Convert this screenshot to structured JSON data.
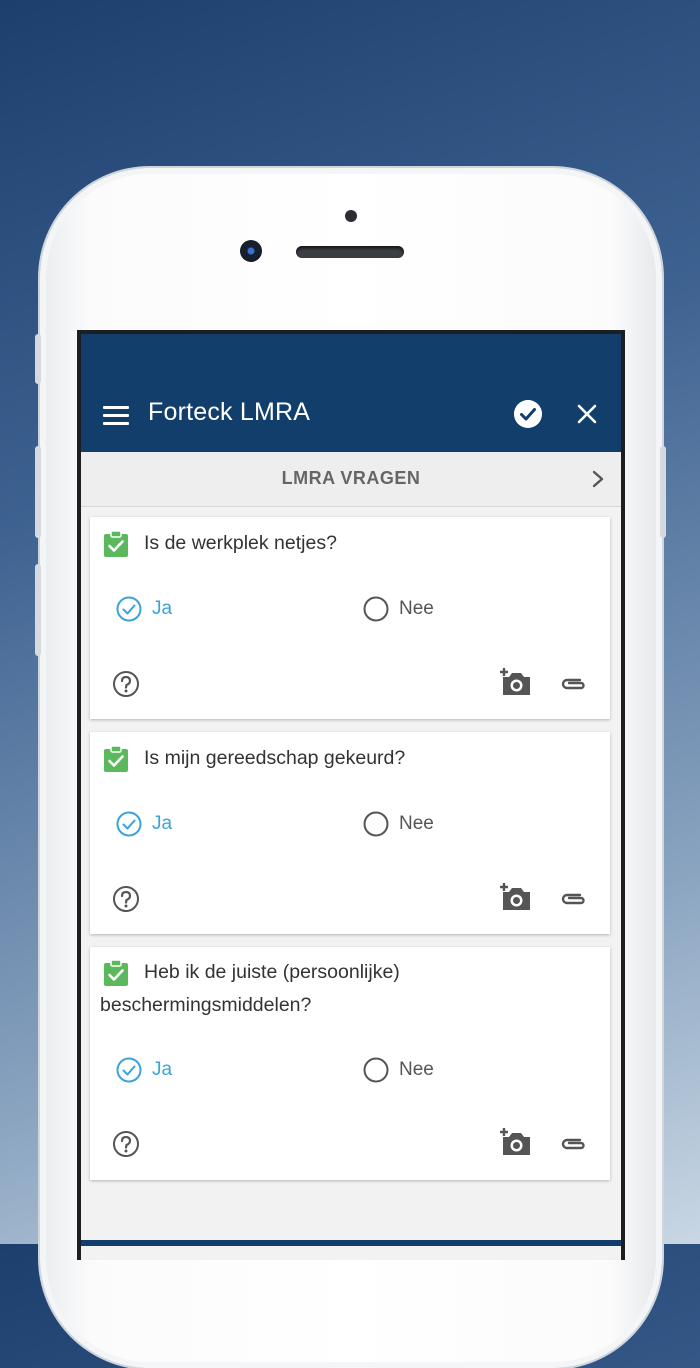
{
  "app": {
    "title": "Forteck LMRA"
  },
  "tab": {
    "label": "LMRA VRAGEN"
  },
  "questions": [
    {
      "text": "Is de werkplek netjes?",
      "yes_label": "Ja",
      "no_label": "Nee",
      "selected": "yes"
    },
    {
      "text": "Is mijn gereedschap gekeurd?",
      "yes_label": "Ja",
      "no_label": "Nee",
      "selected": "yes"
    },
    {
      "text": "Heb ik de juiste (persoonlijke) beschermingsmiddelen?",
      "yes_label": "Ja",
      "no_label": "Nee",
      "selected": "yes"
    }
  ],
  "colors": {
    "appbar": "#123e6c",
    "accent": "#3aa3db",
    "check_badge": "#5cb85c"
  },
  "icons": [
    "menu-icon",
    "check-circle-icon",
    "close-icon",
    "chevron-right-icon",
    "clipboard-check-icon",
    "help-icon",
    "add-photo-icon",
    "attachment-icon"
  ]
}
